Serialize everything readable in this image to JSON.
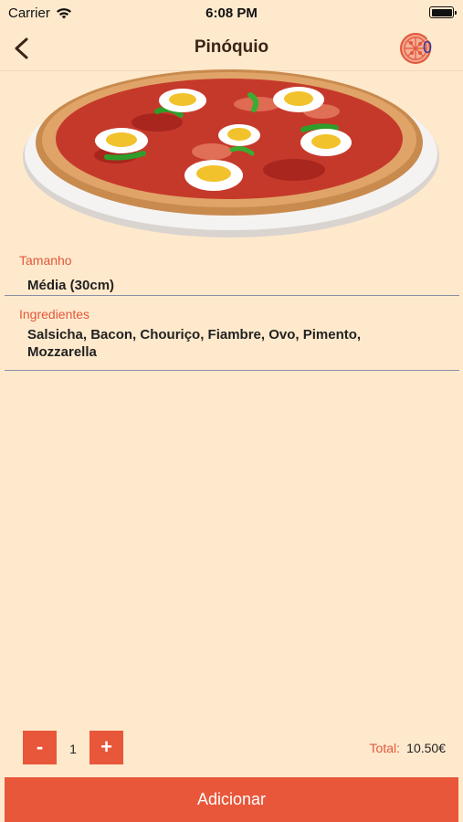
{
  "status_bar": {
    "carrier": "Carrier",
    "time": "6:08 PM"
  },
  "nav": {
    "title": "Pinóquio",
    "cart_count": "0"
  },
  "icons": {
    "back": "chevron-left-icon",
    "cart": "pizza-cart-icon",
    "wifi": "wifi-icon",
    "battery": "battery-icon"
  },
  "product": {
    "size_label": "Tamanho",
    "size_value": "Média (30cm)",
    "ingredients_label": "Ingredientes",
    "ingredients_value": "Salsicha, Bacon, Chouriço, Fiambre, Ovo, Pimento, Mozzarella"
  },
  "order": {
    "decrement": "-",
    "quantity": "1",
    "increment": "+",
    "total_label": "Total:",
    "total_value": "10.50€"
  },
  "actions": {
    "add": "Adicionar"
  },
  "colors": {
    "background": "#ffe9cc",
    "accent": "#e8573a",
    "title": "#3a2418",
    "badge": "#3a3a9a"
  }
}
